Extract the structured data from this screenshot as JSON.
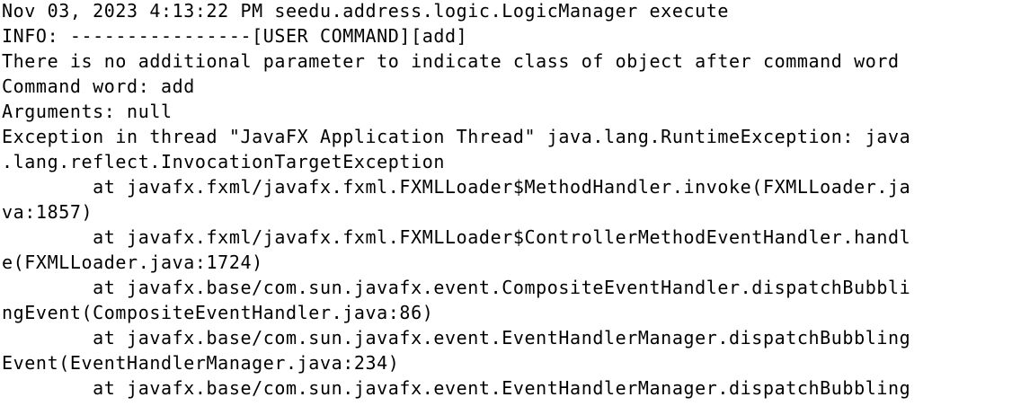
{
  "terminal": {
    "lines": [
      "Nov 03, 2023 4:13:22 PM seedu.address.logic.LogicManager execute",
      "INFO: ----------------[USER COMMAND][add]",
      "There is no additional parameter to indicate class of object after command word",
      "Command word: add",
      "Arguments: null",
      "Exception in thread \"JavaFX Application Thread\" java.lang.RuntimeException: java",
      ".lang.reflect.InvocationTargetException",
      "        at javafx.fxml/javafx.fxml.FXMLLoader$MethodHandler.invoke(FXMLLoader.ja",
      "va:1857)",
      "        at javafx.fxml/javafx.fxml.FXMLLoader$ControllerMethodEventHandler.handl",
      "e(FXMLLoader.java:1724)",
      "        at javafx.base/com.sun.javafx.event.CompositeEventHandler.dispatchBubbli",
      "ngEvent(CompositeEventHandler.java:86)",
      "        at javafx.base/com.sun.javafx.event.EventHandlerManager.dispatchBubbling",
      "Event(EventHandlerManager.java:234)",
      "        at javafx.base/com.sun.javafx.event.EventHandlerManager.dispatchBubbling"
    ]
  }
}
